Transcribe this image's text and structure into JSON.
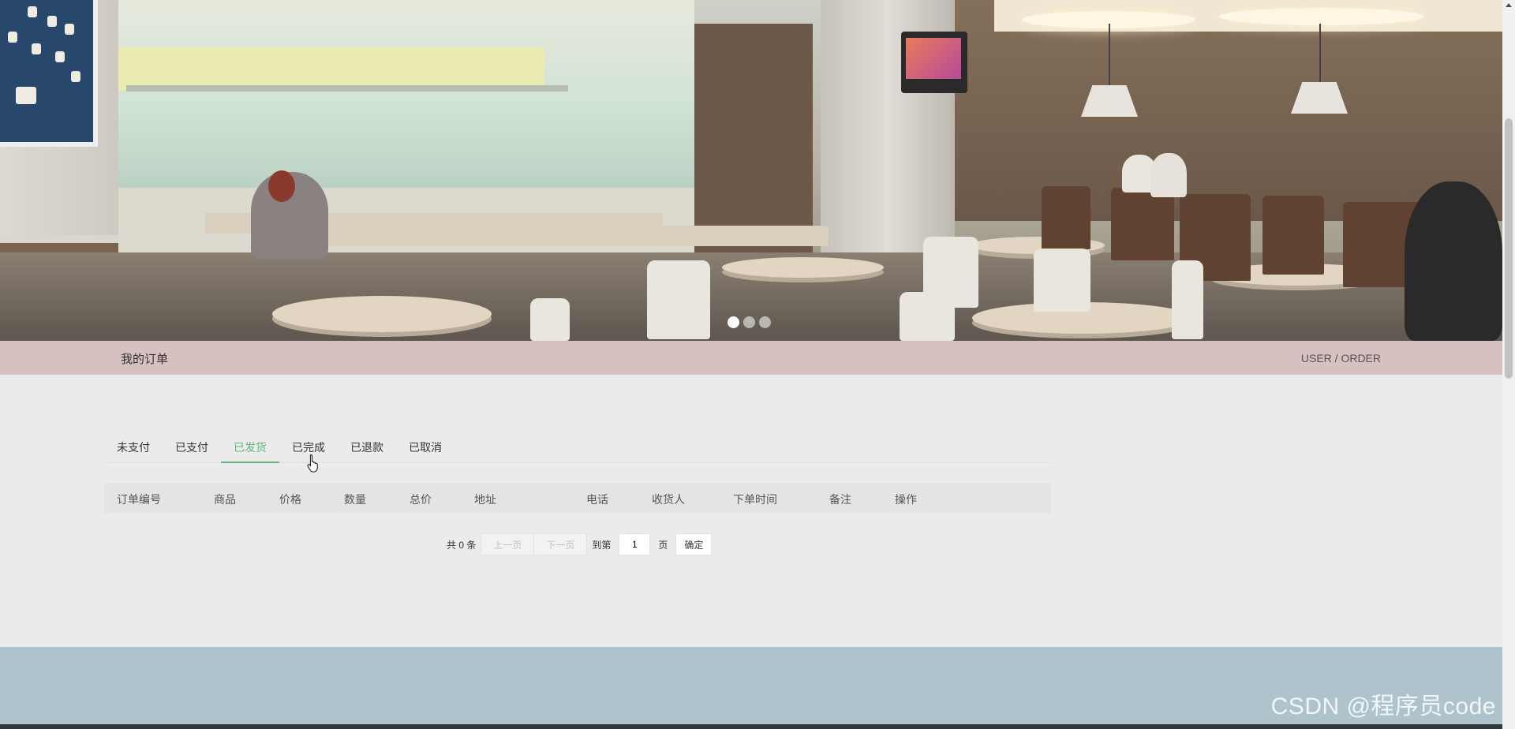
{
  "banner": {
    "slides_total": 3,
    "active_slide": 1
  },
  "title_bar": {
    "title": "我的订单",
    "subtitle": "USER / ORDER"
  },
  "tabs": [
    {
      "label": "未支付"
    },
    {
      "label": "已支付"
    },
    {
      "label": "已发货"
    },
    {
      "label": "已完成"
    },
    {
      "label": "已退款"
    },
    {
      "label": "已取消"
    }
  ],
  "active_tab": "已发货",
  "table": {
    "headers": [
      "订单编号",
      "商品",
      "价格",
      "数量",
      "总价",
      "地址",
      "电话",
      "收货人",
      "下单时间",
      "备注",
      "操作"
    ],
    "rows": []
  },
  "pager": {
    "total_text": "共 0 条",
    "prev": "上一页",
    "next": "下一页",
    "goto": "到第",
    "page_value": "1",
    "page_suffix": "页",
    "confirm": "确定"
  },
  "watermark": "CSDN @程序员code",
  "colors": {
    "accent": "#5fb878",
    "title_bar_bg": "#d6c0c0",
    "footer_bg": "#afc3cd",
    "page_bg": "#ebebeb"
  }
}
